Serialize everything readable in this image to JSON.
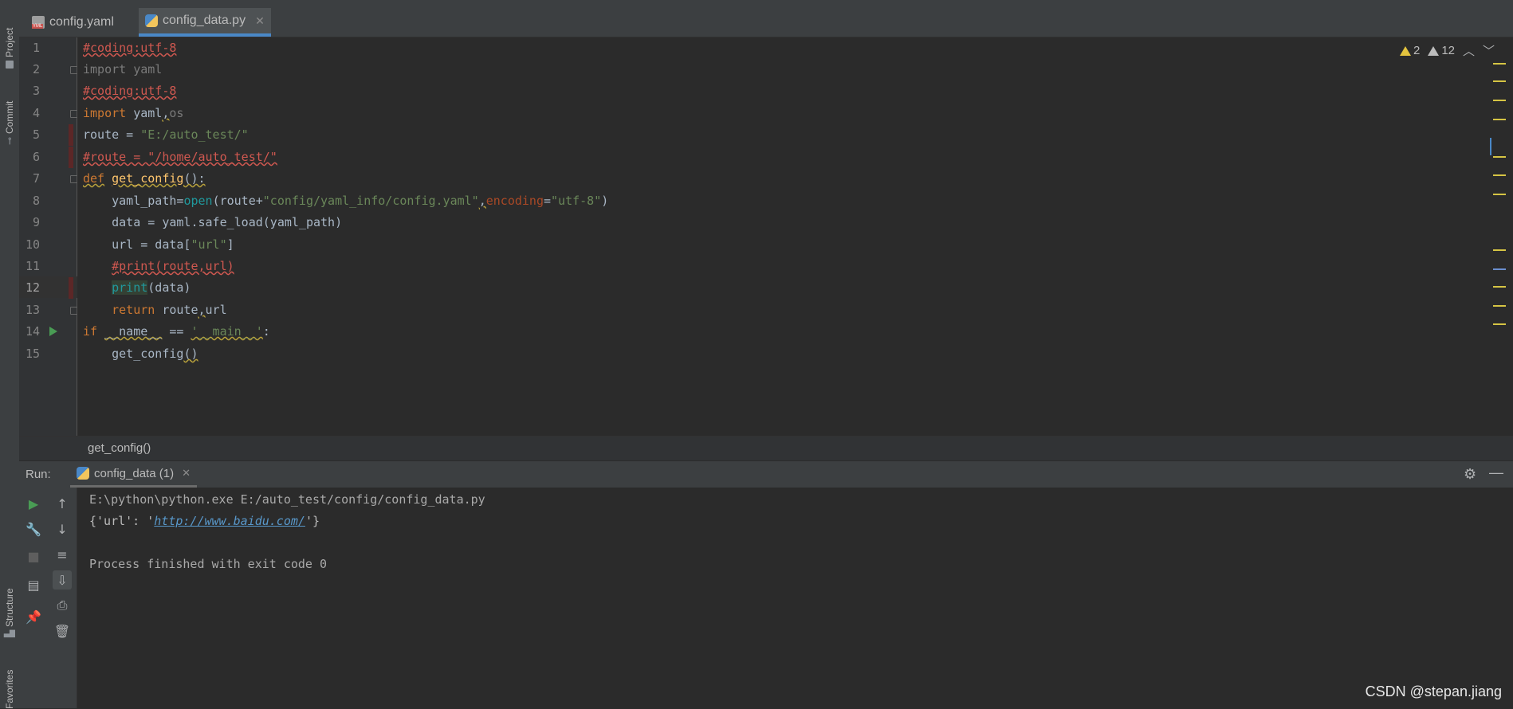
{
  "tabs": [
    {
      "label": "config.yaml",
      "icon": "yaml-file-icon",
      "active": false
    },
    {
      "label": "config_data.py",
      "icon": "python-file-icon",
      "active": true
    }
  ],
  "left_strip": {
    "project": "Project",
    "commit": "Commit",
    "structure": "Structure",
    "favorites": "Favorites"
  },
  "inspections": {
    "warnings": "2",
    "weak_warnings": "12"
  },
  "code_lines": [
    "1",
    "2",
    "3",
    "4",
    "5",
    "6",
    "7",
    "8",
    "9",
    "10",
    "11",
    "12",
    "13",
    "14",
    "15"
  ],
  "breadcrumb": "get_config()",
  "run": {
    "label": "Run:",
    "config_tab": "config_data (1)",
    "console": {
      "line1": "E:\\python\\python.exe E:/auto_test/config/config_data.py",
      "line2_prefix": "{'url': '",
      "line2_link": "http://www.baidu.com/",
      "line2_suffix": "'}",
      "line4": "Process finished with exit code 0"
    }
  },
  "watermark": "CSDN @stepan.jiang",
  "colors": {
    "accent": "#4a88c7",
    "keyword": "#cc7832",
    "string": "#6a8759",
    "comment": "#d05850"
  }
}
